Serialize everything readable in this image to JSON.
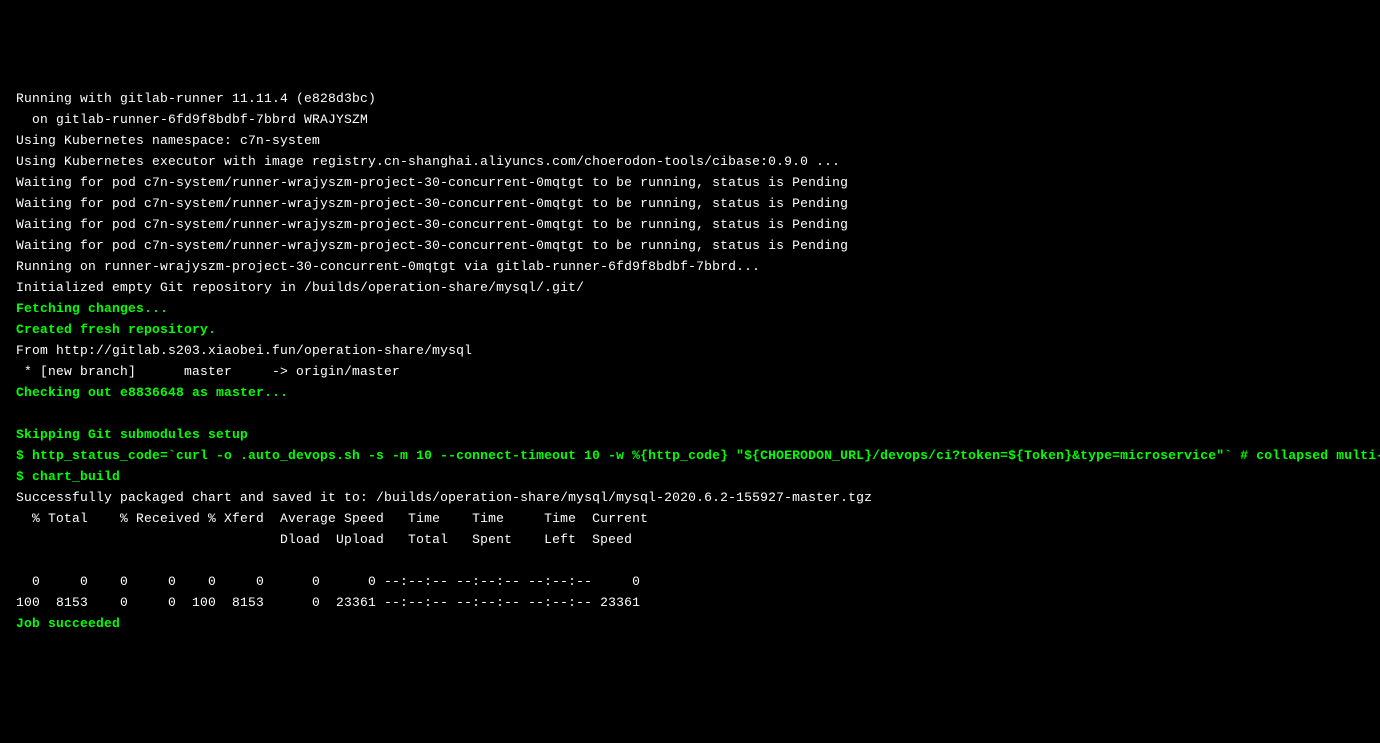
{
  "log": {
    "lines": [
      {
        "text": "Running with gitlab-runner 11.11.4 (e828d3bc)",
        "color": "white"
      },
      {
        "text": "  on gitlab-runner-6fd9f8bdbf-7bbrd WRAJYSZM",
        "color": "white"
      },
      {
        "text": "Using Kubernetes namespace: c7n-system",
        "color": "white"
      },
      {
        "text": "Using Kubernetes executor with image registry.cn-shanghai.aliyuncs.com/choerodon-tools/cibase:0.9.0 ...",
        "color": "white"
      },
      {
        "text": "Waiting for pod c7n-system/runner-wrajyszm-project-30-concurrent-0mqtgt to be running, status is Pending",
        "color": "white"
      },
      {
        "text": "Waiting for pod c7n-system/runner-wrajyszm-project-30-concurrent-0mqtgt to be running, status is Pending",
        "color": "white"
      },
      {
        "text": "Waiting for pod c7n-system/runner-wrajyszm-project-30-concurrent-0mqtgt to be running, status is Pending",
        "color": "white"
      },
      {
        "text": "Waiting for pod c7n-system/runner-wrajyszm-project-30-concurrent-0mqtgt to be running, status is Pending",
        "color": "white"
      },
      {
        "text": "Running on runner-wrajyszm-project-30-concurrent-0mqtgt via gitlab-runner-6fd9f8bdbf-7bbrd...",
        "color": "white"
      },
      {
        "text": "Initialized empty Git repository in /builds/operation-share/mysql/.git/",
        "color": "white"
      },
      {
        "text": "Fetching changes...",
        "color": "green"
      },
      {
        "text": "Created fresh repository.",
        "color": "green"
      },
      {
        "text": "From http://gitlab.s203.xiaobei.fun/operation-share/mysql",
        "color": "white"
      },
      {
        "text": " * [new branch]      master     -> origin/master",
        "color": "white"
      },
      {
        "text": "Checking out e8836648 as master...",
        "color": "green"
      },
      {
        "text": "",
        "color": "white"
      },
      {
        "text": "Skipping Git submodules setup",
        "color": "green"
      },
      {
        "text": "$ http_status_code=`curl -o .auto_devops.sh -s -m 10 --connect-timeout 10 -w %{http_code} \"${CHOERODON_URL}/devops/ci?token=${Token}&type=microservice\"` # collapsed multi-line command",
        "color": "green"
      },
      {
        "text": "$ chart_build",
        "color": "green"
      },
      {
        "text": "Successfully packaged chart and saved it to: /builds/operation-share/mysql/mysql-2020.6.2-155927-master.tgz",
        "color": "white"
      },
      {
        "text": "  % Total    % Received % Xferd  Average Speed   Time    Time     Time  Current",
        "color": "white"
      },
      {
        "text": "                                 Dload  Upload   Total   Spent    Left  Speed",
        "color": "white"
      },
      {
        "text": "",
        "color": "white"
      },
      {
        "text": "  0     0    0     0    0     0      0      0 --:--:-- --:--:-- --:--:--     0",
        "color": "white"
      },
      {
        "text": "100  8153    0     0  100  8153      0  23361 --:--:-- --:--:-- --:--:-- 23361",
        "color": "white"
      },
      {
        "text": "Job succeeded",
        "color": "green"
      }
    ]
  }
}
